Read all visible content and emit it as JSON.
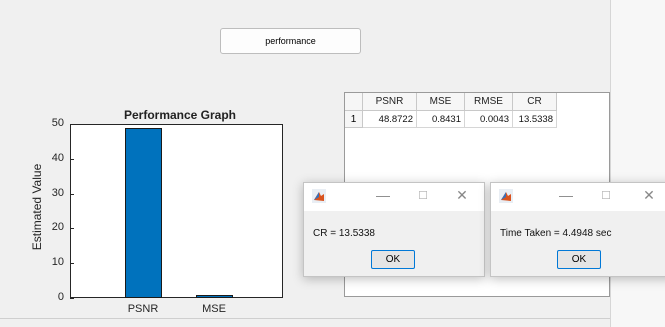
{
  "toolbar": {
    "performance_label": "performance"
  },
  "chart_data": {
    "type": "bar",
    "title": "Performance Graph",
    "ylabel": "Estimated Value",
    "categories": [
      "PSNR",
      "MSE"
    ],
    "values": [
      48.8722,
      0.8431
    ],
    "ylim": [
      0,
      50
    ],
    "yticks": [
      "0",
      "10",
      "20",
      "30",
      "40",
      "50"
    ],
    "bar_color": "#0072bd",
    "grid": false
  },
  "table": {
    "columns": [
      "PSNR",
      "MSE",
      "RMSE",
      "CR"
    ],
    "row_headers": [
      "1"
    ],
    "rows": [
      [
        "48.8722",
        "0.8431",
        "0.0043",
        "13.5338"
      ]
    ]
  },
  "dialogs": {
    "cr": {
      "message": "CR = 13.5338",
      "ok_label": "OK"
    },
    "time": {
      "message": "Time Taken = 4.4948 sec",
      "ok_label": "OK"
    },
    "controls": {
      "minimize": "—",
      "maximize": "☐",
      "close": "✕"
    }
  }
}
